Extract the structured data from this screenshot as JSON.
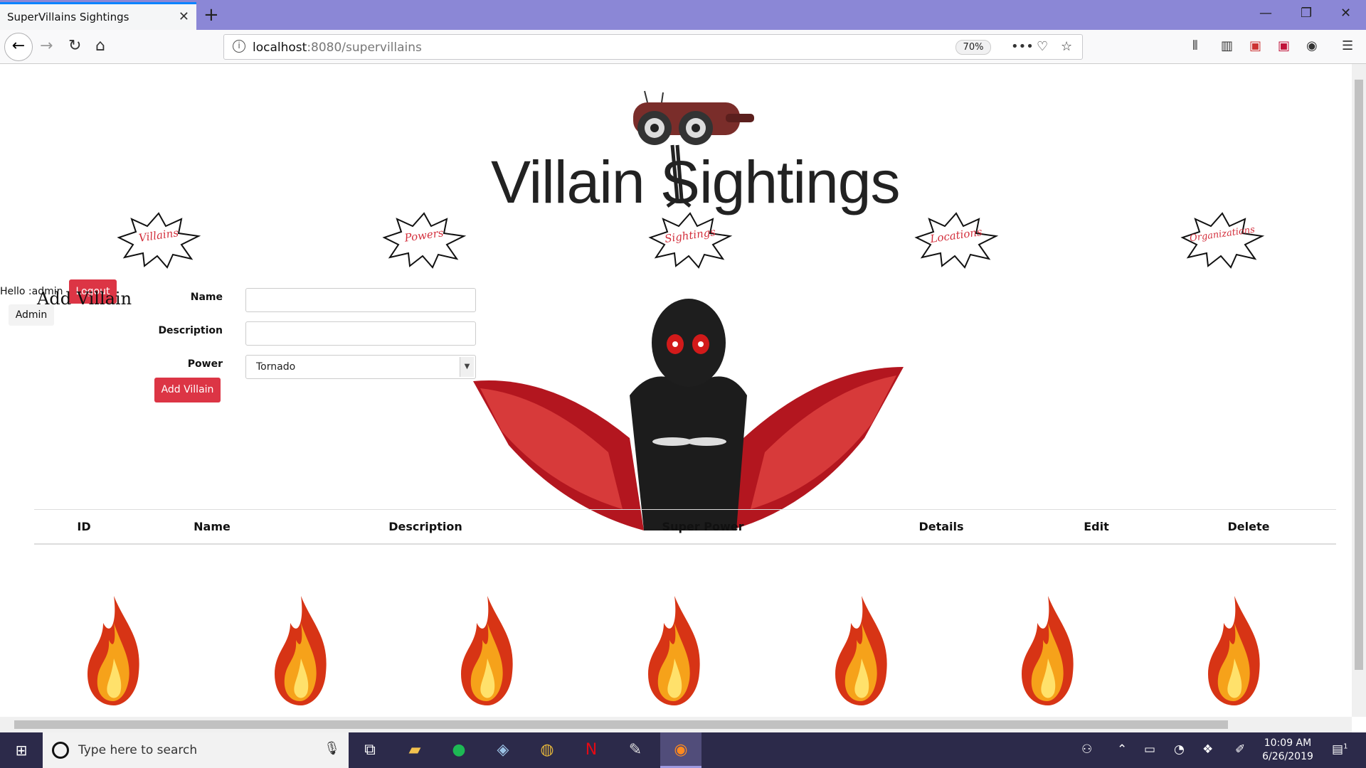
{
  "browser": {
    "tab_title": "SuperVillains Sightings",
    "url_host": "localhost",
    "url_rest": ":8080/supervillains",
    "zoom": "70%"
  },
  "site": {
    "logo_text": "Villain Sightings",
    "nav": [
      {
        "label": "Villains",
        "color": "#d32f3c"
      },
      {
        "label": "Powers",
        "color": "#d32f3c"
      },
      {
        "label": "Sightings",
        "color": "#d32f3c"
      },
      {
        "label": "Locations",
        "color": "#d32f3c"
      },
      {
        "label": "Organizations",
        "color": "#d32f3c"
      }
    ]
  },
  "user": {
    "hello": "Hello :admin",
    "separator": "|",
    "logout_label": "Logout",
    "admin_label": "Admin"
  },
  "form": {
    "title": "Add Villain",
    "name_label": "Name",
    "name_value": "",
    "description_label": "Description",
    "description_value": "",
    "power_label": "Power",
    "power_selected": "Tornado",
    "submit_label": "Add Villain",
    "accent": "#dc3545"
  },
  "table": {
    "headers": [
      "ID",
      "Name",
      "Description",
      "Super Power",
      "Details",
      "Edit",
      "Delete"
    ],
    "rows": []
  },
  "taskbar": {
    "search_placeholder": "Type here to search",
    "time": "10:09 AM",
    "date": "6/26/2019",
    "notification_count": "1"
  }
}
